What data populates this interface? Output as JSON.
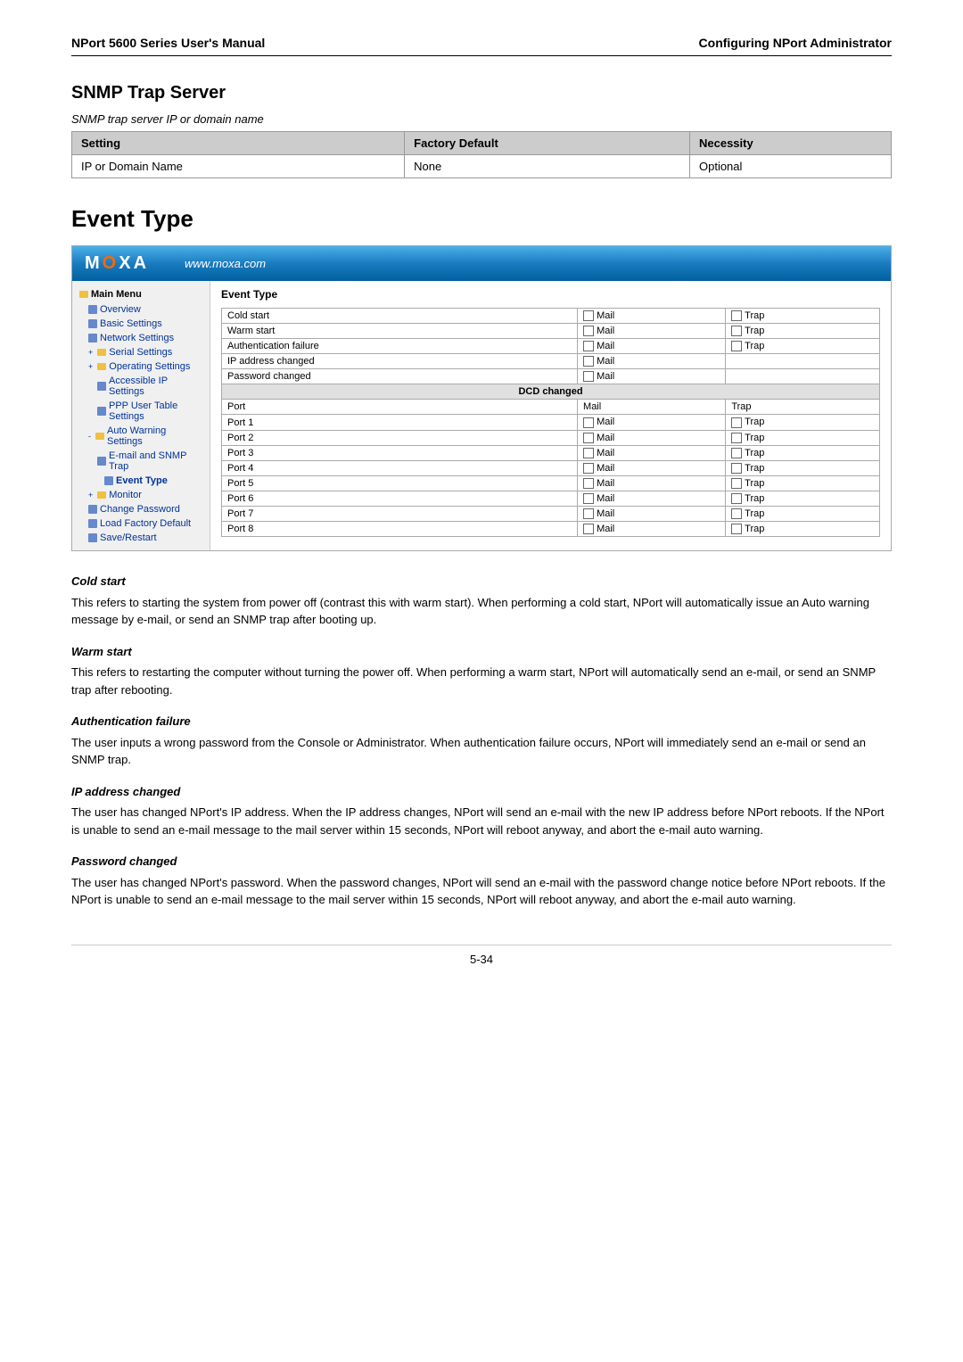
{
  "header": {
    "left": "NPort 5600 Series User's Manual",
    "right": "Configuring NPort Administrator"
  },
  "snmp_section": {
    "title": "SNMP Trap Server",
    "subtitle": "SNMP trap server IP or domain name",
    "table": {
      "columns": [
        "Setting",
        "Factory Default",
        "Necessity"
      ],
      "rows": [
        [
          "IP or Domain Name",
          "None",
          "Optional"
        ]
      ]
    }
  },
  "event_type_section": {
    "title": "Event Type",
    "moxa_logo": "MOXA",
    "moxa_url": "www.moxa.com",
    "sidebar": {
      "items": [
        {
          "label": "Main Menu",
          "level": 0,
          "type": "section"
        },
        {
          "label": "Overview",
          "level": 1,
          "type": "item"
        },
        {
          "label": "Basic Settings",
          "level": 1,
          "type": "item"
        },
        {
          "label": "Network Settings",
          "level": 1,
          "type": "item"
        },
        {
          "label": "Serial Settings",
          "level": 1,
          "type": "item",
          "expandable": true
        },
        {
          "label": "Operating Settings",
          "level": 1,
          "type": "item",
          "expandable": true
        },
        {
          "label": "Accessible IP Settings",
          "level": 2,
          "type": "item"
        },
        {
          "label": "PPP User Table Settings",
          "level": 2,
          "type": "item"
        },
        {
          "label": "Auto Warning Settings",
          "level": 1,
          "type": "item",
          "expandable": true
        },
        {
          "label": "E-mail and SNMP Trap",
          "level": 2,
          "type": "item"
        },
        {
          "label": "Event Type",
          "level": 3,
          "type": "item",
          "active": true
        },
        {
          "label": "Monitor",
          "level": 1,
          "type": "item",
          "expandable": true
        },
        {
          "label": "Change Password",
          "level": 1,
          "type": "item"
        },
        {
          "label": "Load Factory Default",
          "level": 1,
          "type": "item"
        },
        {
          "label": "Save/Restart",
          "level": 1,
          "type": "item"
        }
      ]
    },
    "content_title": "Event Type",
    "events": [
      {
        "name": "Cold start",
        "has_mail": true,
        "has_trap": true,
        "type": "normal"
      },
      {
        "name": "Warm start",
        "has_mail": true,
        "has_trap": true,
        "type": "normal"
      },
      {
        "name": "Authentication failure",
        "has_mail": true,
        "has_trap": true,
        "type": "normal"
      },
      {
        "name": "IP address changed",
        "has_mail": true,
        "has_trap": false,
        "type": "normal"
      },
      {
        "name": "Password changed",
        "has_mail": true,
        "has_trap": false,
        "type": "normal"
      },
      {
        "name": "DCD changed",
        "type": "header"
      },
      {
        "name": "Port",
        "has_mail_label": "Mail",
        "has_trap_label": "Trap",
        "type": "subheader"
      },
      {
        "name": "Port 1",
        "has_mail": true,
        "has_trap": true,
        "type": "normal"
      },
      {
        "name": "Port 2",
        "has_mail": true,
        "has_trap": true,
        "type": "normal"
      },
      {
        "name": "Port 3",
        "has_mail": true,
        "has_trap": true,
        "type": "normal"
      },
      {
        "name": "Port 4",
        "has_mail": true,
        "has_trap": true,
        "type": "normal"
      },
      {
        "name": "Port 5",
        "has_mail": true,
        "has_trap": true,
        "type": "normal"
      },
      {
        "name": "Port 6",
        "has_mail": true,
        "has_trap": true,
        "type": "normal"
      },
      {
        "name": "Port 7",
        "has_mail": true,
        "has_trap": true,
        "type": "normal"
      },
      {
        "name": "Port 8",
        "has_mail": true,
        "has_trap": true,
        "type": "normal"
      }
    ]
  },
  "descriptions": [
    {
      "key": "cold_start",
      "title": "Cold start",
      "text": "This refers to starting the system from power off (contrast this with warm start). When performing a cold start, NPort will automatically issue an Auto warning message by e-mail, or send an SNMP trap after booting up."
    },
    {
      "key": "warm_start",
      "title": "Warm start",
      "text": "This refers to restarting the computer without turning the power off. When performing a warm start, NPort will automatically send an e-mail, or send an SNMP trap after rebooting."
    },
    {
      "key": "auth_failure",
      "title": "Authentication failure",
      "text": "The user inputs a wrong password from the Console or Administrator. When authentication failure occurs, NPort will immediately send an e-mail or send an SNMP trap."
    },
    {
      "key": "ip_changed",
      "title": "IP address changed",
      "text": "The user has changed NPort's IP address. When the IP address changes, NPort will send an e-mail with the new IP address before NPort reboots. If the NPort is unable to send an e-mail message to the mail server within 15 seconds, NPort will reboot anyway, and abort the e-mail auto warning."
    },
    {
      "key": "pwd_changed",
      "title": "Password changed",
      "text": "The user has changed NPort's password. When the password changes, NPort will send an e-mail with the password change notice before NPort reboots. If the NPort is unable to send an e-mail message to the mail server within 15 seconds, NPort will reboot anyway, and abort the e-mail auto warning."
    }
  ],
  "footer": {
    "page": "5-34"
  }
}
